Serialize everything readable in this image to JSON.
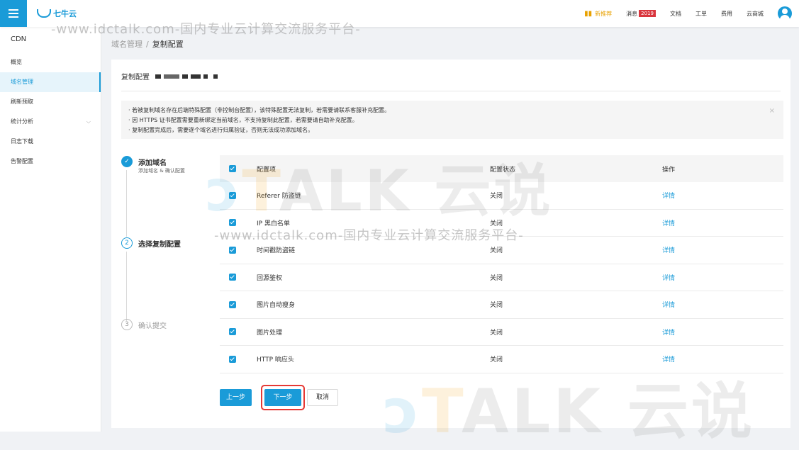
{
  "header": {
    "logo_text": "七牛云",
    "nav": {
      "recommend": "新推荐",
      "messages": "消息",
      "messages_badge": "2019",
      "docs": "文档",
      "ticket": "工单",
      "billing": "费用",
      "market": "云商城"
    }
  },
  "sidebar": {
    "title": "CDN",
    "items": [
      {
        "label": "概览"
      },
      {
        "label": "域名管理"
      },
      {
        "label": "刷新预取"
      },
      {
        "label": "统计分析"
      },
      {
        "label": "日志下载"
      },
      {
        "label": "告警配置"
      }
    ]
  },
  "breadcrumb": {
    "parent": "域名管理",
    "sep": "/",
    "current": "复制配置"
  },
  "card": {
    "title": "复制配置"
  },
  "notice": {
    "lines": [
      "· 若被复制域名存在后端特殊配置（非控制台配置），该特殊配置无法复制，若需要请联系客服补充配置。",
      "· 因 HTTPS 证书配置需要重新绑定当前域名，不支持复制此配置，若需要请自助补充配置。",
      "· 复制配置完成后，需要逐个域名进行归属验证，否则无法成功添加域名。"
    ],
    "close": "×"
  },
  "steps": [
    {
      "number": "✓",
      "title": "添加域名",
      "subtitle": "添加域名 & 确认配置"
    },
    {
      "number": "2",
      "title": "选择复制配置"
    },
    {
      "number": "3",
      "title": "确认提交"
    }
  ],
  "table": {
    "headers": {
      "name": "配置项",
      "status": "配置状态",
      "action": "操作"
    },
    "rows": [
      {
        "name": "Referer 防盗链",
        "status": "关闭",
        "action": "详情"
      },
      {
        "name": "IP 黑白名单",
        "status": "关闭",
        "action": "详情"
      },
      {
        "name": "时间戳防盗链",
        "status": "关闭",
        "action": "详情"
      },
      {
        "name": "回源鉴权",
        "status": "关闭",
        "action": "详情"
      },
      {
        "name": "图片自动瘦身",
        "status": "关闭",
        "action": "详情"
      },
      {
        "name": "图片处理",
        "status": "关闭",
        "action": "详情"
      },
      {
        "name": "HTTP 响应头",
        "status": "关闭",
        "action": "详情"
      }
    ]
  },
  "buttons": {
    "prev": "上一步",
    "next": "下一步",
    "cancel": "取消"
  },
  "watermark": {
    "text": "-www.idctalk.com-国内专业云计算交流服务平台-",
    "brand_a": "ɔ",
    "brand_b": "T",
    "brand_c": "ALK 云说"
  },
  "colors": {
    "accent": "#1a9bd8",
    "highlight_border": "#e53935",
    "badge": "#d9363e",
    "recommend": "#e8a100"
  }
}
